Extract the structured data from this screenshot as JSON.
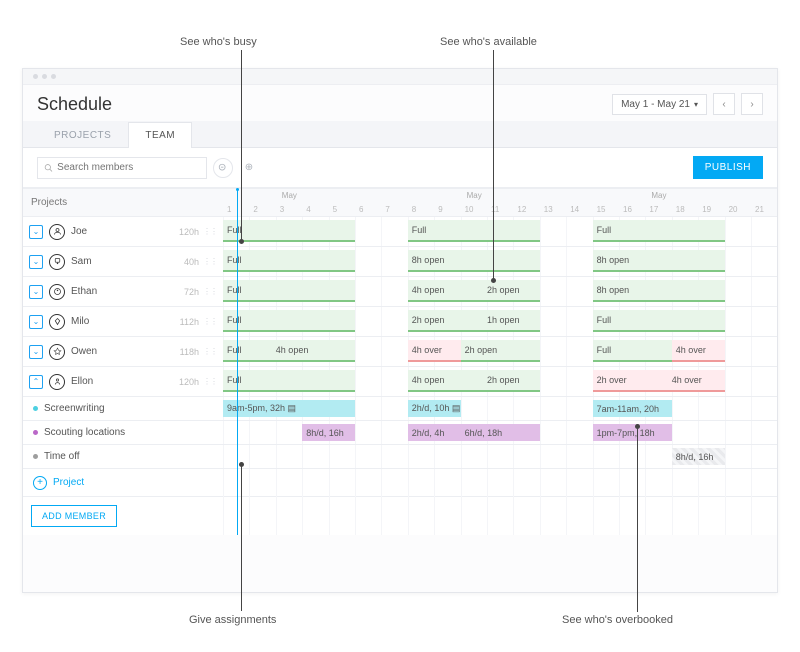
{
  "callouts": {
    "busy": "See who's busy",
    "available": "See who's available",
    "assignments": "Give assignments",
    "overbooked": "See who's overbooked"
  },
  "header": {
    "title": "Schedule",
    "date_range": "May 1 - May 21"
  },
  "tabs": {
    "projects": "PROJECTS",
    "team": "TEAM"
  },
  "search": {
    "placeholder": "Search members"
  },
  "publish_btn": "PUBLISH",
  "projects_header": "Projects",
  "month_label": "May",
  "days": [
    1,
    2,
    3,
    4,
    5,
    6,
    7,
    8,
    9,
    10,
    11,
    12,
    13,
    14,
    15,
    16,
    17,
    18,
    19,
    20,
    21
  ],
  "members": [
    {
      "name": "Joe",
      "hours": "120h",
      "expanded": false,
      "blocks": [
        {
          "col": 1,
          "span": 5,
          "type": "green",
          "label": "Full"
        },
        {
          "col": 8,
          "span": 5,
          "type": "green",
          "label": "Full"
        },
        {
          "col": 15,
          "span": 5,
          "type": "green",
          "label": "Full"
        }
      ]
    },
    {
      "name": "Sam",
      "hours": "40h",
      "expanded": false,
      "blocks": [
        {
          "col": 1,
          "span": 5,
          "type": "green",
          "label": "Full"
        },
        {
          "col": 8,
          "span": 5,
          "type": "green",
          "label": "8h open"
        },
        {
          "col": 15,
          "span": 5,
          "type": "green",
          "label": "8h open"
        }
      ]
    },
    {
      "name": "Ethan",
      "hours": "72h",
      "expanded": false,
      "blocks": [
        {
          "col": 1,
          "span": 5,
          "type": "green",
          "label": "Full"
        },
        {
          "col": 8,
          "span": 5,
          "type": "green",
          "label": "4h open",
          "label2": "2h open",
          "split": 3
        },
        {
          "col": 15,
          "span": 5,
          "type": "green",
          "label": "8h open"
        }
      ]
    },
    {
      "name": "Milo",
      "hours": "112h",
      "expanded": false,
      "blocks": [
        {
          "col": 1,
          "span": 5,
          "type": "green",
          "label": "Full"
        },
        {
          "col": 8,
          "span": 5,
          "type": "green",
          "label": "2h open",
          "label2": "1h open",
          "split": 3
        },
        {
          "col": 15,
          "span": 5,
          "type": "green",
          "label": "Full"
        }
      ]
    },
    {
      "name": "Owen",
      "hours": "118h",
      "expanded": false,
      "blocks": [
        {
          "col": 1,
          "span": 5,
          "type": "green",
          "label": "Full",
          "label2": "4h open",
          "split": 2
        },
        {
          "col": 8,
          "span": 5,
          "type": "mixed",
          "label": "4h over",
          "label2": "2h open",
          "split": 2,
          "left_type": "red",
          "right_type": "green"
        },
        {
          "col": 15,
          "span": 5,
          "type": "mixed",
          "label": "Full",
          "label2": "4h over",
          "split": 3,
          "left_type": "green",
          "right_type": "red"
        }
      ]
    },
    {
      "name": "Ellon",
      "hours": "120h",
      "expanded": true,
      "blocks": [
        {
          "col": 1,
          "span": 5,
          "type": "green",
          "label": "Full"
        },
        {
          "col": 8,
          "span": 5,
          "type": "green",
          "label": "4h open",
          "label2": "2h open",
          "split": 3
        },
        {
          "col": 15,
          "span": 5,
          "type": "red",
          "label": "2h over",
          "label2": "4h over",
          "split": 3
        }
      ]
    }
  ],
  "subprojects": [
    {
      "name": "Screenwriting",
      "dot": "teal",
      "blocks": [
        {
          "col": 1,
          "span": 5,
          "type": "teal",
          "label": "9am-5pm, 32h ▤"
        },
        {
          "col": 8,
          "span": 2,
          "type": "teal",
          "label": "2h/d, 10h ▤"
        },
        {
          "col": 15,
          "span": 3,
          "type": "teal",
          "label": "7am-11am, 20h"
        }
      ]
    },
    {
      "name": "Scouting locations",
      "dot": "purple",
      "blocks": [
        {
          "col": 4,
          "span": 2,
          "type": "purple",
          "label": "8h/d, 16h"
        },
        {
          "col": 8,
          "span": 2,
          "type": "purple",
          "label": "2h/d, 4h"
        },
        {
          "col": 10,
          "span": 3,
          "type": "purple",
          "label": "6h/d, 18h"
        },
        {
          "col": 15,
          "span": 3,
          "type": "purple",
          "label": "1pm-7pm, 18h"
        }
      ]
    },
    {
      "name": "Time off",
      "dot": "gray",
      "blocks": [
        {
          "col": 18,
          "span": 2,
          "type": "gray",
          "label": "8h/d, 16h"
        }
      ]
    }
  ],
  "add_project": "Project",
  "add_member": "ADD MEMBER"
}
